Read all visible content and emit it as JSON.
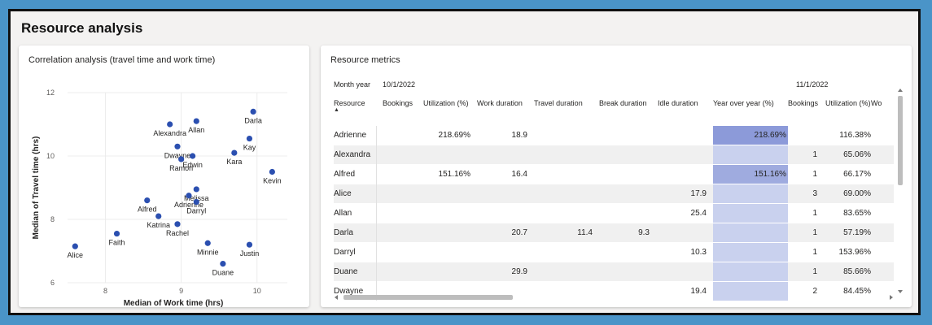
{
  "page": {
    "title": "Resource analysis"
  },
  "correlation": {
    "title": "Correlation analysis (travel time and work time)",
    "chart_data": {
      "type": "scatter",
      "xlabel": "Median of Work time (hrs)",
      "ylabel": "Median of Travel time (hrs)",
      "xlim": [
        7.5,
        10.4
      ],
      "ylim": [
        6,
        12
      ],
      "xticks": [
        8,
        9,
        10
      ],
      "yticks": [
        6,
        8,
        10,
        12
      ],
      "grid": true,
      "color": "#2b4fb0",
      "points": [
        {
          "label": "Alexandra",
          "x": 8.85,
          "y": 11.0
        },
        {
          "label": "Allan",
          "x": 9.2,
          "y": 11.1
        },
        {
          "label": "Darla",
          "x": 9.95,
          "y": 11.4
        },
        {
          "label": "Kay",
          "x": 9.9,
          "y": 10.55
        },
        {
          "label": "Dwayne",
          "x": 8.95,
          "y": 10.3
        },
        {
          "label": "Edwin",
          "x": 9.15,
          "y": 10.0
        },
        {
          "label": "Ramon",
          "x": 9.0,
          "y": 9.9
        },
        {
          "label": "Kara",
          "x": 9.7,
          "y": 10.1
        },
        {
          "label": "Kevin",
          "x": 10.2,
          "y": 9.5
        },
        {
          "label": "Melissa",
          "x": 9.2,
          "y": 8.95
        },
        {
          "label": "Adrienne",
          "x": 9.1,
          "y": 8.75
        },
        {
          "label": "Alfred",
          "x": 8.55,
          "y": 8.6
        },
        {
          "label": "Darryl",
          "x": 9.2,
          "y": 8.55
        },
        {
          "label": "Katrina",
          "x": 8.7,
          "y": 8.1
        },
        {
          "label": "Rachel",
          "x": 8.95,
          "y": 7.85
        },
        {
          "label": "Faith",
          "x": 8.15,
          "y": 7.55
        },
        {
          "label": "Alice",
          "x": 7.6,
          "y": 7.15
        },
        {
          "label": "Minnie",
          "x": 9.35,
          "y": 7.25
        },
        {
          "label": "Justin",
          "x": 9.9,
          "y": 7.2
        },
        {
          "label": "Duane",
          "x": 9.55,
          "y": 6.6
        }
      ]
    }
  },
  "metrics": {
    "title": "Resource metrics",
    "month_label": "Month year",
    "months": [
      "10/1/2022",
      "11/1/2022"
    ],
    "resource_header": "Resource",
    "columns": [
      "Bookings",
      "Utilization (%)",
      "Work duration",
      "Travel duration",
      "Break duration",
      "Idle duration",
      "Year over year (%)",
      "Bookings",
      "Utilization (%)",
      "Wo"
    ],
    "rows": [
      {
        "name": "Adrienne",
        "c": [
          "",
          "218.69%",
          "18.9",
          "",
          "",
          "",
          "218.69%",
          "",
          "116.38%"
        ]
      },
      {
        "name": "Alexandra",
        "c": [
          "",
          "",
          "",
          "",
          "",
          "",
          "",
          "1",
          "65.06%"
        ]
      },
      {
        "name": "Alfred",
        "c": [
          "",
          "151.16%",
          "16.4",
          "",
          "",
          "",
          "151.16%",
          "1",
          "66.17%"
        ]
      },
      {
        "name": "Alice",
        "c": [
          "",
          "",
          "",
          "",
          "",
          "17.9",
          "",
          "3",
          "69.00%"
        ]
      },
      {
        "name": "Allan",
        "c": [
          "",
          "",
          "",
          "",
          "",
          "25.4",
          "",
          "1",
          "83.65%"
        ]
      },
      {
        "name": "Darla",
        "c": [
          "",
          "",
          "20.7",
          "11.4",
          "9.3",
          "",
          "",
          "1",
          "57.19%"
        ]
      },
      {
        "name": "Darryl",
        "c": [
          "",
          "",
          "",
          "",
          "",
          "10.3",
          "",
          "1",
          "153.96%"
        ]
      },
      {
        "name": "Duane",
        "c": [
          "",
          "",
          "29.9",
          "",
          "",
          "",
          "",
          "1",
          "85.66%"
        ]
      },
      {
        "name": "Dwayne",
        "c": [
          "",
          "",
          "",
          "",
          "",
          "19.4",
          "",
          "2",
          "84.45%"
        ]
      }
    ],
    "yoy_highlight": {
      "Adrienne": "#8c9ad9",
      "Alfred": "#9fabdf"
    }
  }
}
